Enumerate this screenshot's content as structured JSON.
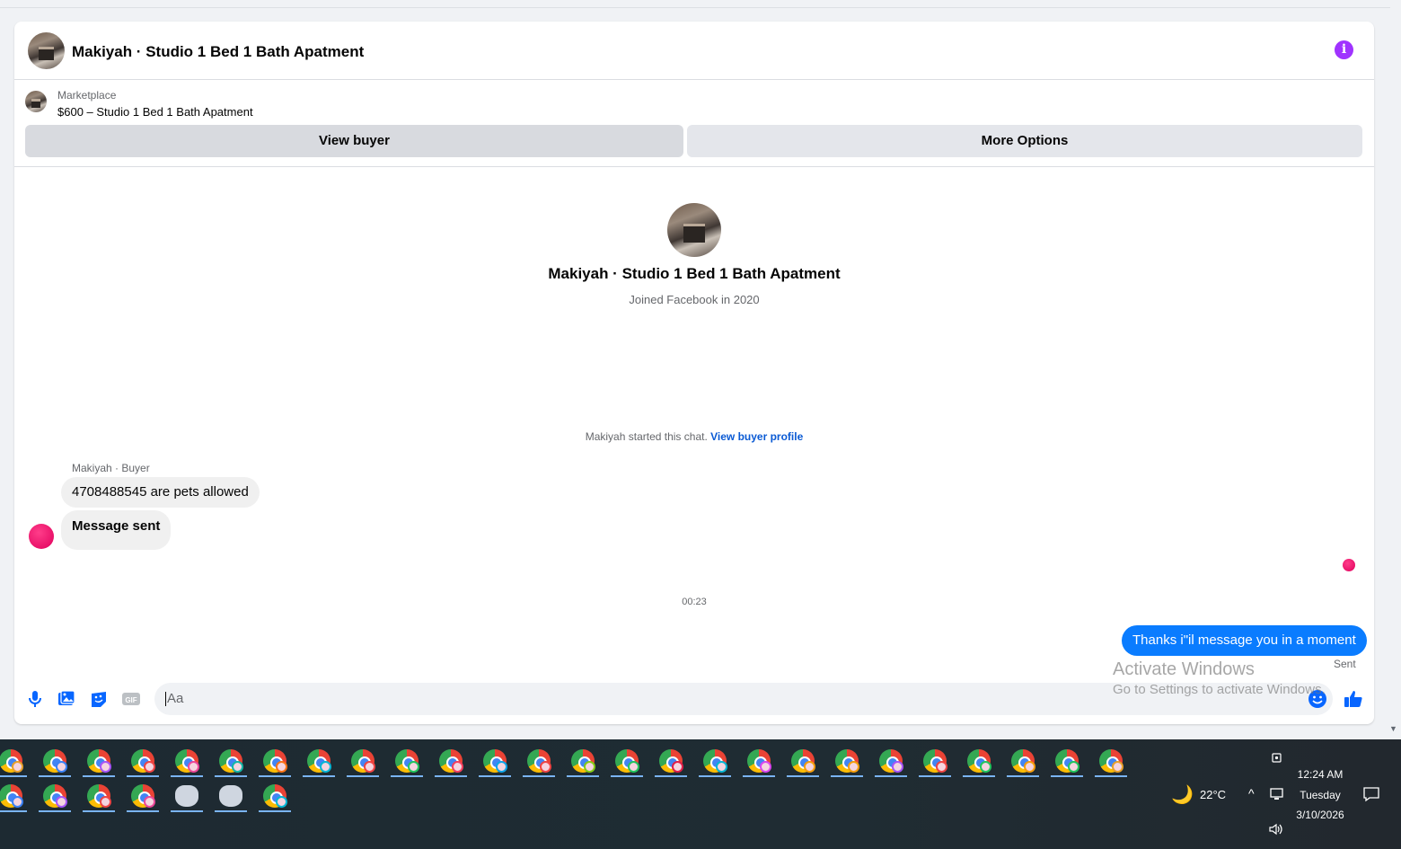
{
  "header": {
    "title": "Makiyah · Studio 1 Bed 1 Bath Apatment"
  },
  "marketplace": {
    "label": "Marketplace",
    "listing": "$600 – Studio 1 Bed 1 Bath Apatment",
    "view_buyer_label": "View buyer",
    "more_options_label": "More Options"
  },
  "profile": {
    "name": "Makiyah · Studio 1 Bed 1 Bath Apatment",
    "joined": "Joined Facebook in 2020"
  },
  "chat": {
    "started_text": "Makiyah started this chat.",
    "view_buyer_profile_link": "View buyer profile",
    "sender_label": "Makiyah · Buyer",
    "messages_in": [
      "4708488545 are pets allowed",
      "Message sent"
    ],
    "timestamp": "00:23",
    "message_out": "Thanks i\"il message you in a moment",
    "sent_status": "Sent"
  },
  "composer": {
    "placeholder": "Aa"
  },
  "watermark": {
    "line1": "Activate Windows",
    "line2": "Go to Settings to activate Windows."
  },
  "taskbar": {
    "weather_icon": "moon-icon",
    "temperature": "22°C",
    "time": "12:24 AM",
    "day": "Tuesday",
    "date": "3/10/2026"
  },
  "colors": {
    "accent": "#0a7cff",
    "info": "#a033ff",
    "link": "#0a5ad4",
    "avatar_pink": "#e0005c"
  }
}
